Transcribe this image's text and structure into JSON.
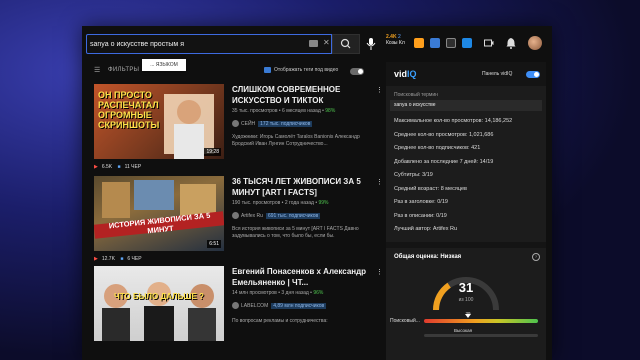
{
  "search": {
    "value": "sanya о искусстве простым я",
    "suggestion": "... ЯЗЫКОМ"
  },
  "ext": {
    "score": "2.4K",
    "score2": "2",
    "line2a": "Козы",
    "line2b": "Кл"
  },
  "filters": {
    "label": "ФИЛЬТРЫ",
    "tags_toggle_label": "Отображать теги под видео"
  },
  "videos": [
    {
      "title": "СЛИШКОМ СОВРЕМЕННОЕ ИСКУССТВО И ТИКТОК",
      "views": "35 тыс. просмотров",
      "age": "6 месяцев назад",
      "score": "98%",
      "channel": "СЕЙН",
      "subs": "172 тыс. подписчиков",
      "desc": "Художники: Игорь Самолёт Taralos Banionis Александр Бродский Иван Лунгин Сотрудничество...",
      "thumb_text": "ОН ПРОСТО РАСПЕЧАТАЛ ОГРОМНЫЕ СКРИНШОТЫ",
      "duration": "19:28",
      "likes": "6.5K",
      "trend": "11 ЧЕР"
    },
    {
      "title": "36 ТЫСЯЧ ЛЕТ ЖИВОПИСИ ЗА 5 МИНУТ [ART I FACTS]",
      "views": "190 тыс. просмотров",
      "age": "2 года назад",
      "score": "99%",
      "channel": "Artifex Ru",
      "subs": "691 тыс. подписчиков",
      "desc": "Вся история живописи за 5 минут [ART I FACTS Давно задумывались о том, что было бы, если бы.",
      "thumb_text": "ИСТОРИЯ ЖИВОПИСИ ЗА 5 МИНУТ",
      "duration": "6:51",
      "likes": "12.7K",
      "trend": "6 ЧЕР"
    },
    {
      "title": "Евгений Понасенков х Александр Емельяненко | ЧТ...",
      "views": "14 млн просмотров",
      "age": "3 дня назад",
      "score": "96%",
      "channel": "LABELCOM",
      "subs": "4,89 млн подписчиков",
      "desc": "По вопросам рекламы и сотрудничества:",
      "thumb_text": "ЧТО БЫЛО ДАЛЬШЕ ?",
      "duration": "",
      "likes": "",
      "trend": ""
    }
  ],
  "vidiq": {
    "logo_a": "vid",
    "logo_b": "IQ",
    "panel_label": "Панель vidIQ",
    "search_term_label": "Поисковый термин",
    "search_term": "sanya о искусстве",
    "rows": [
      {
        "label": "Максимальное кол-во просмотров:",
        "value": "14,186,252"
      },
      {
        "label": "Среднее кол-во просмотров:",
        "value": "1,021,686"
      },
      {
        "label": "Среднее кол-во подписчиков:",
        "value": "421"
      },
      {
        "label": "Добавлено за последние 7 дней:",
        "value": "14/19"
      },
      {
        "label": "Субтитры:",
        "value": "3/19"
      },
      {
        "label": "Средний возраст:",
        "value": "8 месяцев"
      },
      {
        "label": "Раз в заголовке:",
        "value": "0/19"
      },
      {
        "label": "Раз в описании:",
        "value": "0/19"
      },
      {
        "label": "Лучший автор:",
        "value": "Artifex Ru"
      }
    ],
    "overall_label": "Общая оценка: Низкая",
    "overall_score": "31",
    "overall_sub": "из 100",
    "overall_fraction": 0.31,
    "search_volume_label": "Поисковый...",
    "search_volume_top": "39",
    "search_volume_fraction": 0.39,
    "competition_label": "Высокая",
    "colors": {
      "accent": "#3aa0ff",
      "gauge_fill": "#f0a020"
    }
  }
}
